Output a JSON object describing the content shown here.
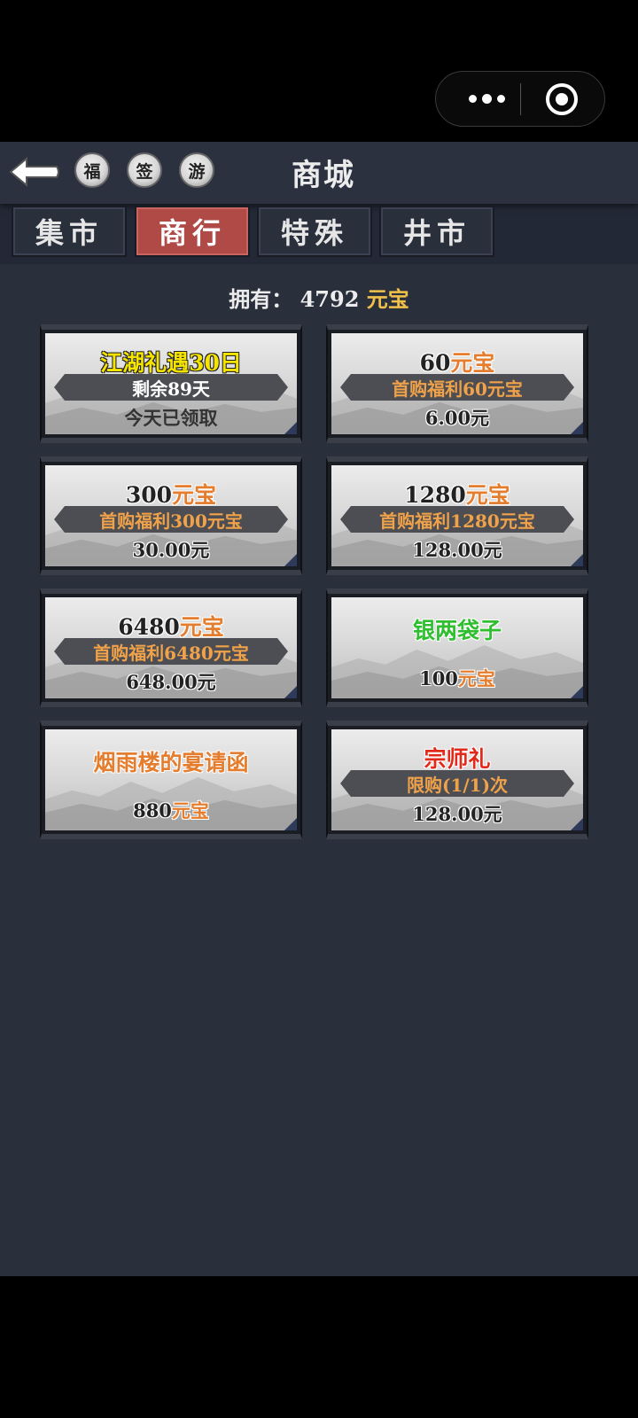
{
  "header": {
    "title": "商城",
    "quick_buttons": [
      "福",
      "签",
      "游"
    ]
  },
  "tabs": [
    {
      "label": "集市",
      "active": false
    },
    {
      "label": "商行",
      "active": true
    },
    {
      "label": "特殊",
      "active": false
    },
    {
      "label": "井市",
      "active": false
    }
  ],
  "balance": {
    "prefix": "拥有：",
    "amount": "4792",
    "unit": "元宝"
  },
  "products": [
    {
      "name": "江湖礼遇30日",
      "name_color": "#f5e400",
      "ribbon": "剩余89天",
      "ribbon_color": "#ffffff",
      "price": "今天已领取",
      "price_color": "#333333"
    },
    {
      "name_num": "60",
      "name_unit": "元宝",
      "ribbon": "首购福利60元宝",
      "ribbon_color": "#f0a24a",
      "price": "6.00元"
    },
    {
      "name_num": "300",
      "name_unit": "元宝",
      "ribbon": "首购福利300元宝",
      "ribbon_color": "#f0a24a",
      "price": "30.00元"
    },
    {
      "name_num": "1280",
      "name_unit": "元宝",
      "ribbon": "首购福利1280元宝",
      "ribbon_color": "#f0a24a",
      "price": "128.00元"
    },
    {
      "name_num": "6480",
      "name_unit": "元宝",
      "ribbon": "首购福利6480元宝",
      "ribbon_color": "#f0a24a",
      "price": "648.00元"
    },
    {
      "name": "银两袋子",
      "name_color": "#2fbe2f",
      "price_num": "100",
      "price_unit": "元宝"
    },
    {
      "name": "烟雨楼的宴请函",
      "name_color": "#e57d2e",
      "price_num": "880",
      "price_unit": "元宝"
    },
    {
      "name": "宗师礼",
      "name_color": "#e02a1c",
      "ribbon": "限购(1/1)次",
      "ribbon_color": "#f0a24a",
      "price": "128.00元"
    }
  ],
  "colors": {
    "gold": "#f1c04a",
    "orange_unit": "#e57d2e",
    "active_tab": "#b04a47"
  }
}
